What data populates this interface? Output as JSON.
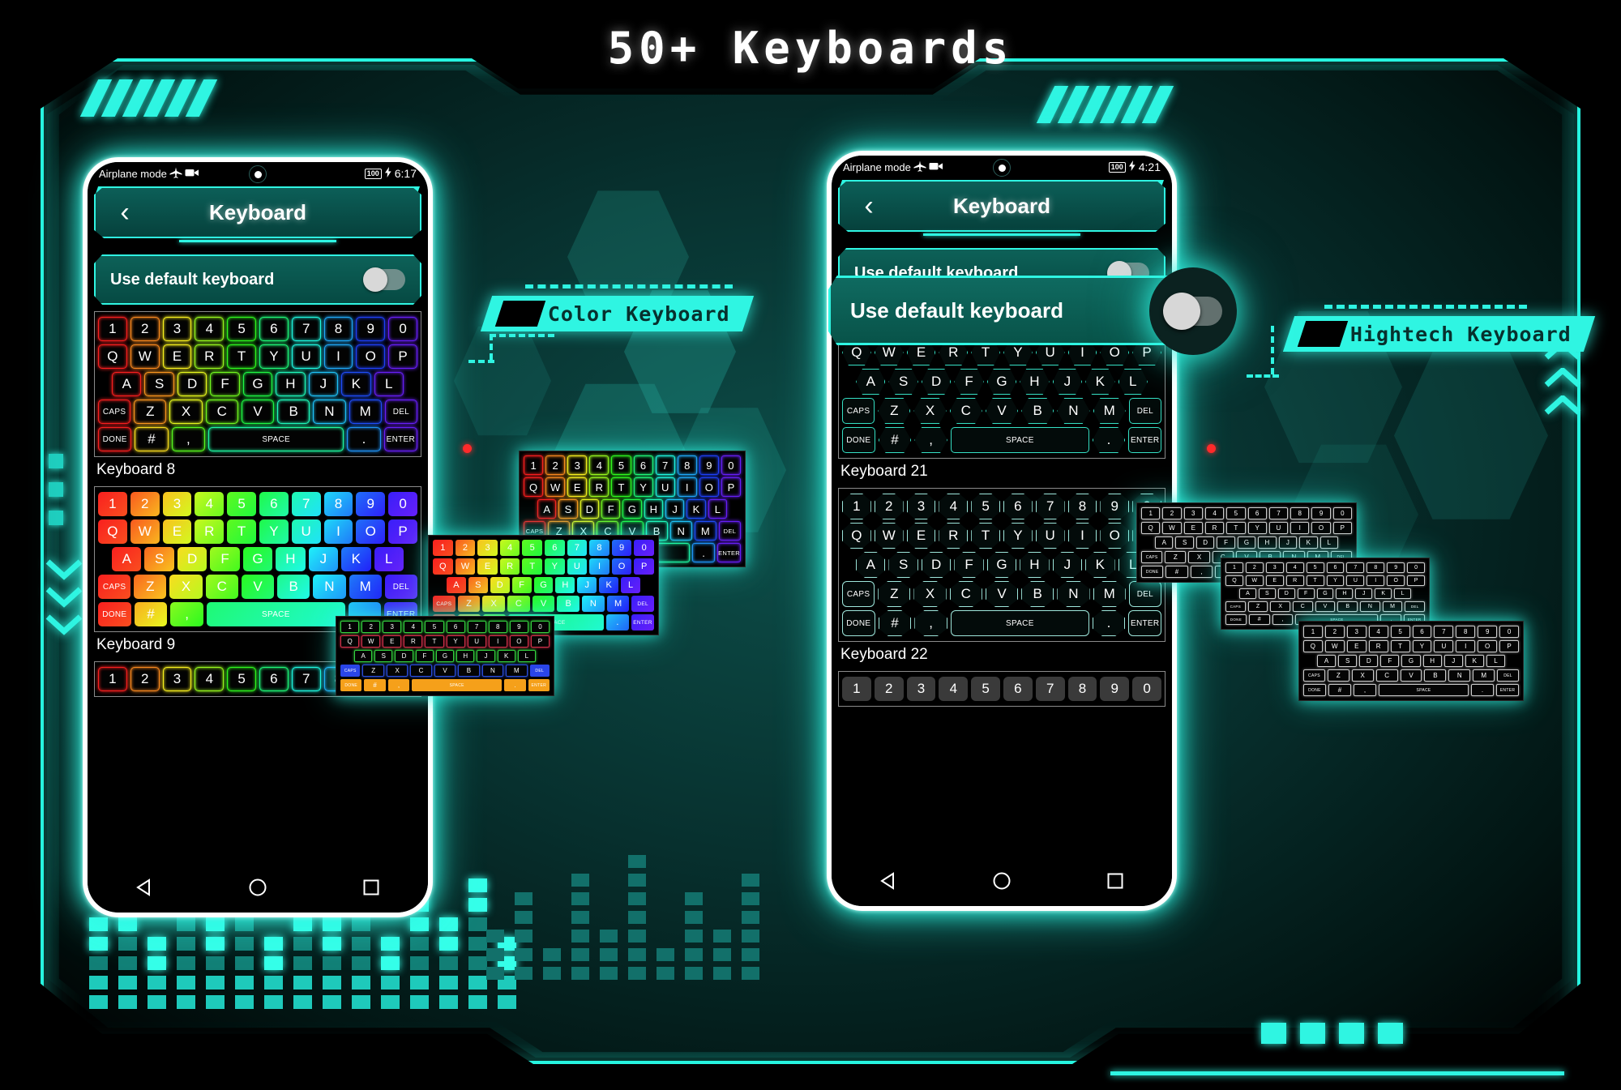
{
  "title": "50+ Keyboards",
  "badges": {
    "left": {
      "label": "Color Keyboard"
    },
    "right": {
      "label": "Hightech Keyboard"
    }
  },
  "magnifier": {
    "label": "Use default keyboard"
  },
  "phone_left": {
    "status": {
      "text": "Airplane mode",
      "airplane_icon": "airplane-icon",
      "video_icon": "camcorder-icon",
      "battery": "100",
      "charging_icon": "charging-bolt-icon",
      "time": "6:17"
    },
    "appbar": {
      "back_icon": "back-chevron-icon",
      "title": "Keyboard"
    },
    "default_row": {
      "label": "Use default keyboard",
      "toggle_state": "off"
    },
    "keyboards": [
      {
        "name": "Keyboard 8",
        "style": "neon-outline-rainbow"
      },
      {
        "name": "Keyboard 9",
        "style": "solid-rainbow"
      }
    ],
    "nav": {
      "back": "nav-back-icon",
      "home": "nav-home-icon",
      "recents": "nav-recents-icon"
    }
  },
  "phone_right": {
    "status": {
      "text": "Airplane mode",
      "airplane_icon": "airplane-icon",
      "video_icon": "camcorder-icon",
      "battery": "100",
      "charging_icon": "charging-bolt-icon",
      "time": "4:21"
    },
    "appbar": {
      "back_icon": "back-chevron-icon",
      "title": "Keyboard"
    },
    "default_row": {
      "label": "Use default keyboard",
      "toggle_state": "off"
    },
    "keyboards": [
      {
        "name": "Keyboard 21",
        "style": "hexagon-teal"
      },
      {
        "name": "Keyboard 22",
        "style": "octagon-outline"
      }
    ],
    "nav": {
      "back": "nav-back-icon",
      "home": "nav-home-icon",
      "recents": "nav-recents-icon"
    }
  },
  "keyboard_layout": {
    "row1": [
      "1",
      "2",
      "3",
      "4",
      "5",
      "6",
      "7",
      "8",
      "9",
      "0"
    ],
    "row2": [
      "Q",
      "W",
      "E",
      "R",
      "T",
      "Y",
      "U",
      "I",
      "O",
      "P"
    ],
    "row3": [
      "A",
      "S",
      "D",
      "F",
      "G",
      "H",
      "J",
      "K",
      "L"
    ],
    "row4": [
      "CAPS",
      "Z",
      "X",
      "C",
      "V",
      "B",
      "N",
      "M",
      "DEL"
    ],
    "row5": [
      "DONE",
      "#",
      ",",
      "SPACE",
      ".",
      "ENTER"
    ]
  },
  "colors": {
    "accent": "#2ff5e2",
    "panel": "#0d6158",
    "background": "#07302e",
    "badge_text": "#07312e",
    "hex_key_outline": "#35e0c4",
    "oct_key_outline": "#9fe8dd",
    "rainbow": [
      "#ff1133",
      "#ff1170",
      "#ff22b4",
      "#e832e0",
      "#d060c0",
      "#c08f70",
      "#d8d43a",
      "#a8e032",
      "#4fe07a",
      "#35d8c8",
      "#2ec0f0",
      "#2a78f5"
    ]
  }
}
